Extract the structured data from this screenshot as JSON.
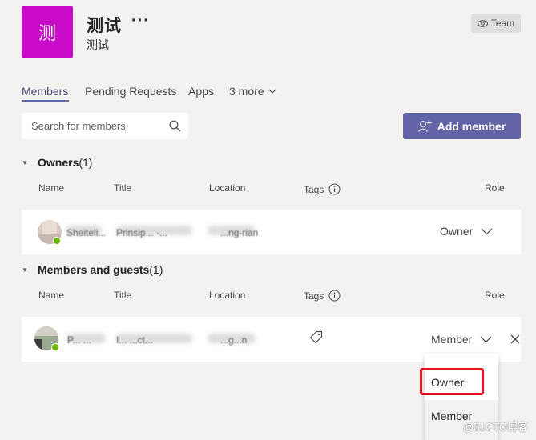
{
  "team": {
    "avatar_text": "测",
    "avatar_color": "#c90bc9",
    "name": "测试",
    "more_label": "···",
    "description": "测试",
    "visibility_label": "Team"
  },
  "tabs": [
    {
      "label": "Members",
      "active": true
    },
    {
      "label": "Pending Requests",
      "active": false
    },
    {
      "label": "Apps",
      "active": false
    },
    {
      "label": "3 more",
      "active": false
    }
  ],
  "search": {
    "placeholder": "Search for members"
  },
  "add_member": {
    "label": "Add member"
  },
  "columns": {
    "name": "Name",
    "title": "Title",
    "location": "Location",
    "tags": "Tags",
    "role": "Role"
  },
  "owners": {
    "title": "Owners",
    "count": "(1)",
    "rows": [
      {
        "name": "Sheiteli...",
        "title": "Prinsip... ·...",
        "location": "...ng-rian",
        "role": "Owner"
      }
    ]
  },
  "members": {
    "title": "Members and guests",
    "count": "(1)",
    "rows": [
      {
        "name": "P... ...",
        "title": "I... ...ct...",
        "location": "...g...n",
        "role": "Member"
      }
    ]
  },
  "role_dropdown": {
    "options": [
      "Owner",
      "Member"
    ],
    "highlighted": "Owner"
  },
  "colors": {
    "accent": "#6264a7",
    "highlight_border": "#e81123",
    "presence": "#6bb700"
  },
  "watermark": "@51CTO博客"
}
